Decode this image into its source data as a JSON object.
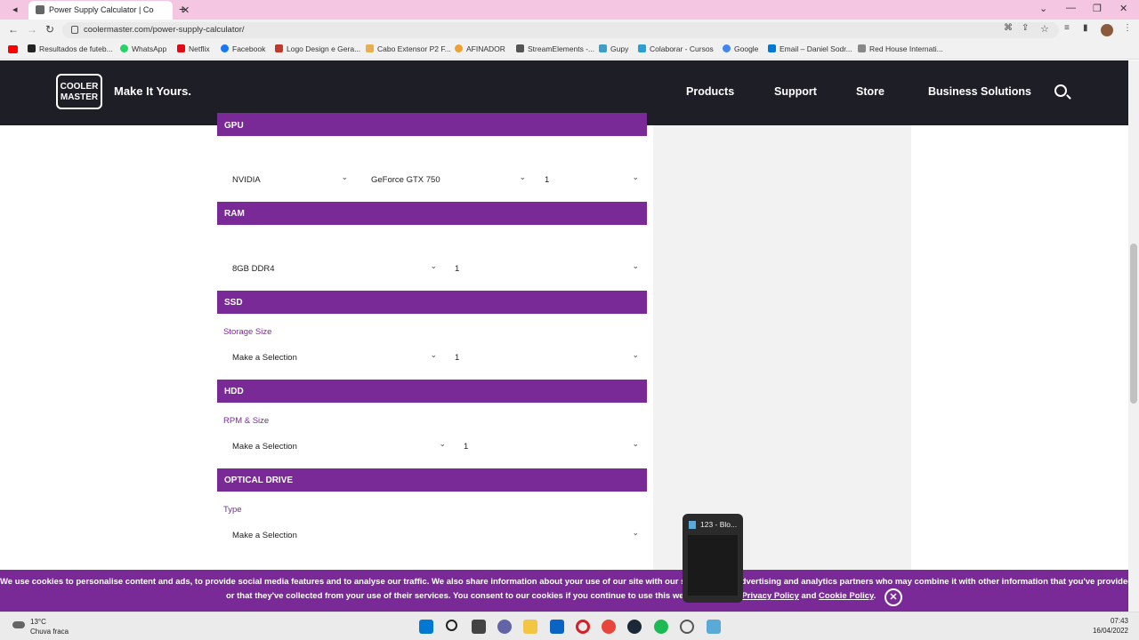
{
  "browser": {
    "tab_title": "Power Supply Calculator | Cooler Master",
    "new_tab_glyph": "+",
    "url": "coolermaster.com/power-supply-calculator/",
    "window_controls": [
      "⌄",
      "—",
      "❐",
      "✕"
    ]
  },
  "bookmarks": [
    {
      "label": "Resultados de futeb...",
      "icon_color": "#222"
    },
    {
      "label": "WhatsApp",
      "icon_color": "#25d366"
    },
    {
      "label": "Netflix",
      "icon_color": "#e50914"
    },
    {
      "label": "Facebook",
      "icon_color": "#1877f2"
    },
    {
      "label": "Logo Design e Gera...",
      "icon_color": "#c0392b"
    },
    {
      "label": "Cabo Extensor P2 F...",
      "icon_color": "#e8b04c"
    },
    {
      "label": "AFINADOR",
      "icon_color": "#f0a030"
    },
    {
      "label": "StreamElements -...",
      "icon_color": "#555"
    },
    {
      "label": "Gupy",
      "icon_color": "#3aa0c8"
    },
    {
      "label": "Colaborar - Cursos",
      "icon_color": "#2a9fd6"
    },
    {
      "label": "Google",
      "icon_color": "#4285f4"
    },
    {
      "label": "Email – Daniel Sodr...",
      "icon_color": "#0078d4"
    },
    {
      "label": "Red House Internati...",
      "icon_color": "#888"
    }
  ],
  "site": {
    "logo_text": "COOLER MASTER",
    "tagline": "Make It Yours.",
    "nav": [
      "Products",
      "Support",
      "Store",
      "Business Solutions"
    ]
  },
  "sections": {
    "gpu": {
      "title": "GPU",
      "brand": "NVIDIA",
      "model": "GeForce GTX 750",
      "qty": "1"
    },
    "ram": {
      "title": "RAM",
      "type": "8GB DDR4",
      "qty": "1"
    },
    "ssd": {
      "title": "SSD",
      "label": "Storage Size",
      "value": "Make a Selection",
      "qty": "1"
    },
    "hdd": {
      "title": "HDD",
      "label": "RPM & Size",
      "value": "Make a Selection",
      "qty": "1"
    },
    "optical": {
      "title": "OPTICAL DRIVE",
      "label": "Type",
      "value": "Make a Selection"
    }
  },
  "cookie": {
    "line1": "We use cookies to personalise content and ads, to provide social media features and to analyse our traffic. We also share information about your use of our site with our social media, advertising and analytics partners who may combine it with other information that you've provided to them",
    "line2_prefix": "or that they've collected from your use of their services. You consent to our cookies if you continue to use this website. See our",
    "privacy_link": "Privacy Policy",
    "and": "and",
    "cookie_link": "Cookie Policy",
    "period": "."
  },
  "preview": {
    "title": "123 - Blo..."
  },
  "taskbar": {
    "temperature": "13°C",
    "condition": "Chuva fraca",
    "time": "07:43",
    "date": "16/04/2022"
  },
  "colors": {
    "brand_purple": "#7a2a97",
    "header_dark": "#1e1e26"
  }
}
